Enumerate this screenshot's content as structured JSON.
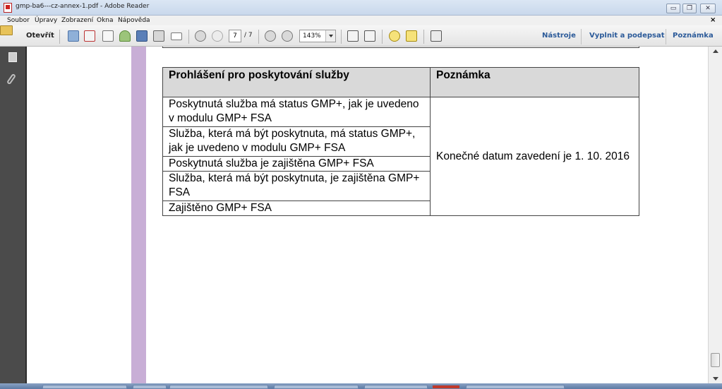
{
  "window": {
    "title": "gmp-ba6---cz-annex-1.pdf - Adobe Reader",
    "buttons": {
      "minimize": "▭",
      "restore": "❐",
      "close": "✕"
    }
  },
  "menu": {
    "items": [
      "Soubor",
      "Úpravy",
      "Zobrazení",
      "Okna",
      "Nápověda"
    ],
    "close_doc": "×"
  },
  "toolbar": {
    "open_label": "Otevřít",
    "page_current": "7",
    "page_total": "/ 7",
    "zoom": "143%",
    "links": [
      "Nástroje",
      "Vyplnit a podepsat",
      "Poznámka"
    ]
  },
  "document": {
    "table": {
      "headers": [
        "Prohlášení pro poskytování služby",
        "Poznámka"
      ],
      "rows": [
        "Poskytnutá služba má status GMP+, jak je uvedeno v modulu GMP+ FSA",
        "Služba, která má být poskytnuta, má status GMP+, jak je uvedeno v modulu GMP+ FSA",
        "Poskytnutá služba je zajištěna GMP+ FSA",
        "Služba, která má být poskytnuta, je zajištěna GMP+ FSA",
        "Zajištěno GMP+ FSA"
      ],
      "note": "Konečné datum zavedení je 1. 10. 2016"
    }
  },
  "colors": {
    "nav_pane": "#4b4b4b",
    "purple_margin": "#c8aed6",
    "header_fill": "#d9d9d9",
    "link_blue": "#2b5a99"
  }
}
